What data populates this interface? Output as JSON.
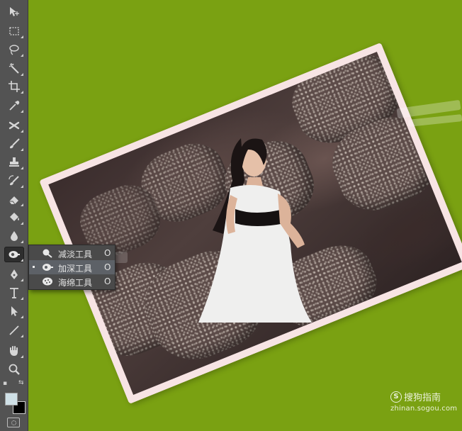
{
  "toolbar": {
    "tools": [
      {
        "id": "move",
        "icon": "move-icon",
        "glyph": "✥"
      },
      {
        "id": "marquee",
        "icon": "rect-marquee-icon",
        "glyph": "⬚"
      },
      {
        "id": "lasso",
        "icon": "lasso-icon",
        "glyph": "ℓ"
      },
      {
        "id": "magic-wand",
        "icon": "magic-wand-icon",
        "glyph": "✶"
      },
      {
        "id": "crop",
        "icon": "crop-icon",
        "glyph": "⌗"
      },
      {
        "id": "eyedropper",
        "icon": "eyedropper-icon",
        "glyph": "⟋"
      },
      {
        "id": "healing",
        "icon": "healing-brush-icon",
        "glyph": "✜"
      },
      {
        "id": "brush",
        "icon": "brush-icon",
        "glyph": "✎"
      },
      {
        "id": "stamp",
        "icon": "clone-stamp-icon",
        "glyph": "⊥"
      },
      {
        "id": "history-brush",
        "icon": "history-brush-icon",
        "glyph": "↺"
      },
      {
        "id": "eraser",
        "icon": "eraser-icon",
        "glyph": "◿"
      },
      {
        "id": "paint-bucket",
        "icon": "paint-bucket-icon",
        "glyph": "◈"
      },
      {
        "id": "blur",
        "icon": "blur-icon",
        "glyph": "💧"
      },
      {
        "id": "dodge",
        "icon": "dodge-burn-icon",
        "glyph": "◒"
      },
      {
        "id": "pen",
        "icon": "pen-icon",
        "glyph": "✒"
      },
      {
        "id": "type",
        "icon": "type-icon",
        "glyph": "T"
      },
      {
        "id": "path-select",
        "icon": "path-selection-icon",
        "glyph": "➤"
      },
      {
        "id": "line",
        "icon": "line-icon",
        "glyph": "╱"
      },
      {
        "id": "hand",
        "icon": "hand-icon",
        "glyph": "✋"
      },
      {
        "id": "zoom",
        "icon": "zoom-icon",
        "glyph": "⚲"
      }
    ],
    "foreground_color": "#cfe0e6",
    "background_color": "#000000"
  },
  "flyout": {
    "items": [
      {
        "label": "减淡工具",
        "shortcut": "O",
        "icon": "dodge-tool-icon",
        "selected": false
      },
      {
        "label": "加深工具",
        "shortcut": "O",
        "icon": "burn-tool-icon",
        "selected": true
      },
      {
        "label": "海绵工具",
        "shortcut": "O",
        "icon": "sponge-tool-icon",
        "selected": false
      }
    ]
  },
  "canvas": {
    "background_color": "#7aa112",
    "frame_color": "#f7e4e4"
  },
  "watermark": {
    "logo_letter": "S",
    "brand": "搜狗指南",
    "url": "zhinan.sogou.com"
  }
}
